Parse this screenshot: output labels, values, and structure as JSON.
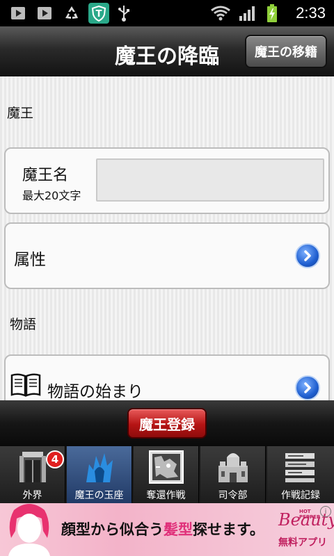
{
  "status_bar": {
    "time": "2:33",
    "icons": [
      "play-store-icon",
      "play-store-icon",
      "recycle-icon",
      "shield-t-icon",
      "usb-icon",
      "wifi-icon",
      "signal-icon",
      "battery-charging-icon"
    ]
  },
  "header": {
    "title": "魔王の降臨",
    "transfer_button": "魔王の移籍"
  },
  "main": {
    "section_maou": "魔王",
    "name_label": "魔王名",
    "name_hint": "最大20文字",
    "name_value": "",
    "attribute_label": "属性",
    "section_story": "物語",
    "story_start_label": "物語の始まり"
  },
  "footer": {
    "register_button": "魔王登録"
  },
  "tabs": [
    {
      "label": "外界",
      "badge": "4"
    },
    {
      "label": "魔王の玉座"
    },
    {
      "label": "奪還作戦"
    },
    {
      "label": "司令部"
    },
    {
      "label": "作戦記録"
    }
  ],
  "ad": {
    "text_pre": "顔型から似合う",
    "text_highlight": "髪型",
    "text_post": "探せます。",
    "brand": "Beauty",
    "brand_sub": "無料アプリ",
    "brand_tag": "HOT PEPPER"
  },
  "colors": {
    "accent_blue": "#1f5fd0",
    "register_red": "#b51414",
    "badge_red": "#e02020",
    "ad_pink": "#f3b3c9",
    "highlight_pink": "#e0307a"
  }
}
